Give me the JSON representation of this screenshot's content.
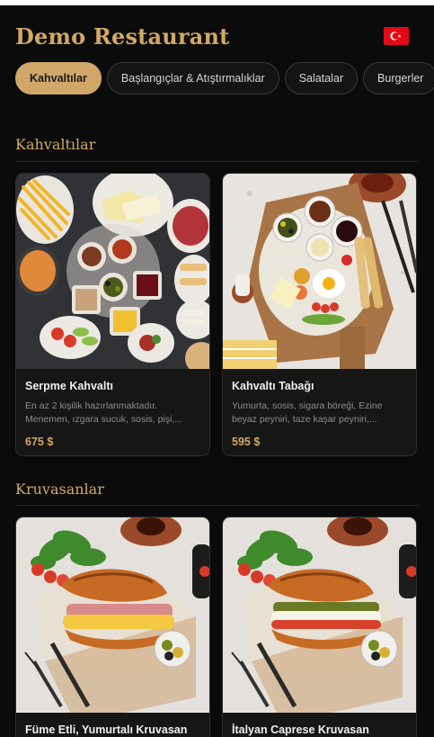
{
  "restaurant": {
    "name": "Demo Restaurant",
    "language_flag": "turkey-flag-icon"
  },
  "colors": {
    "accent": "#d4a864",
    "background": "#0b0b0b",
    "card": "#161616"
  },
  "tabs": [
    {
      "label": "Kahvaltılar",
      "active": true
    },
    {
      "label": "Başlangıçlar & Atıştırmalıklar",
      "active": false
    },
    {
      "label": "Salatalar",
      "active": false
    },
    {
      "label": "Burgerler",
      "active": false
    }
  ],
  "sections": [
    {
      "title": "Kahvaltılar",
      "items": [
        {
          "name": "Serpme Kahvaltı",
          "description": "En az 2 kişilik hazırlanmaktadır. Menemen, ızgara sucuk, sosis, pişi,...",
          "price": "675 $"
        },
        {
          "name": "Kahvaltı Tabağı",
          "description": "Yumurta, sosis, sigara böreği, Ezine beyaz peyniri, taze kaşar peyniri,...",
          "price": "595 $"
        }
      ]
    },
    {
      "title": "Kruvasanlar",
      "items": [
        {
          "name": "Füme Etli, Yumurtalı Kruvasan"
        },
        {
          "name": "İtalyan Caprese Kruvasan"
        }
      ]
    }
  ]
}
